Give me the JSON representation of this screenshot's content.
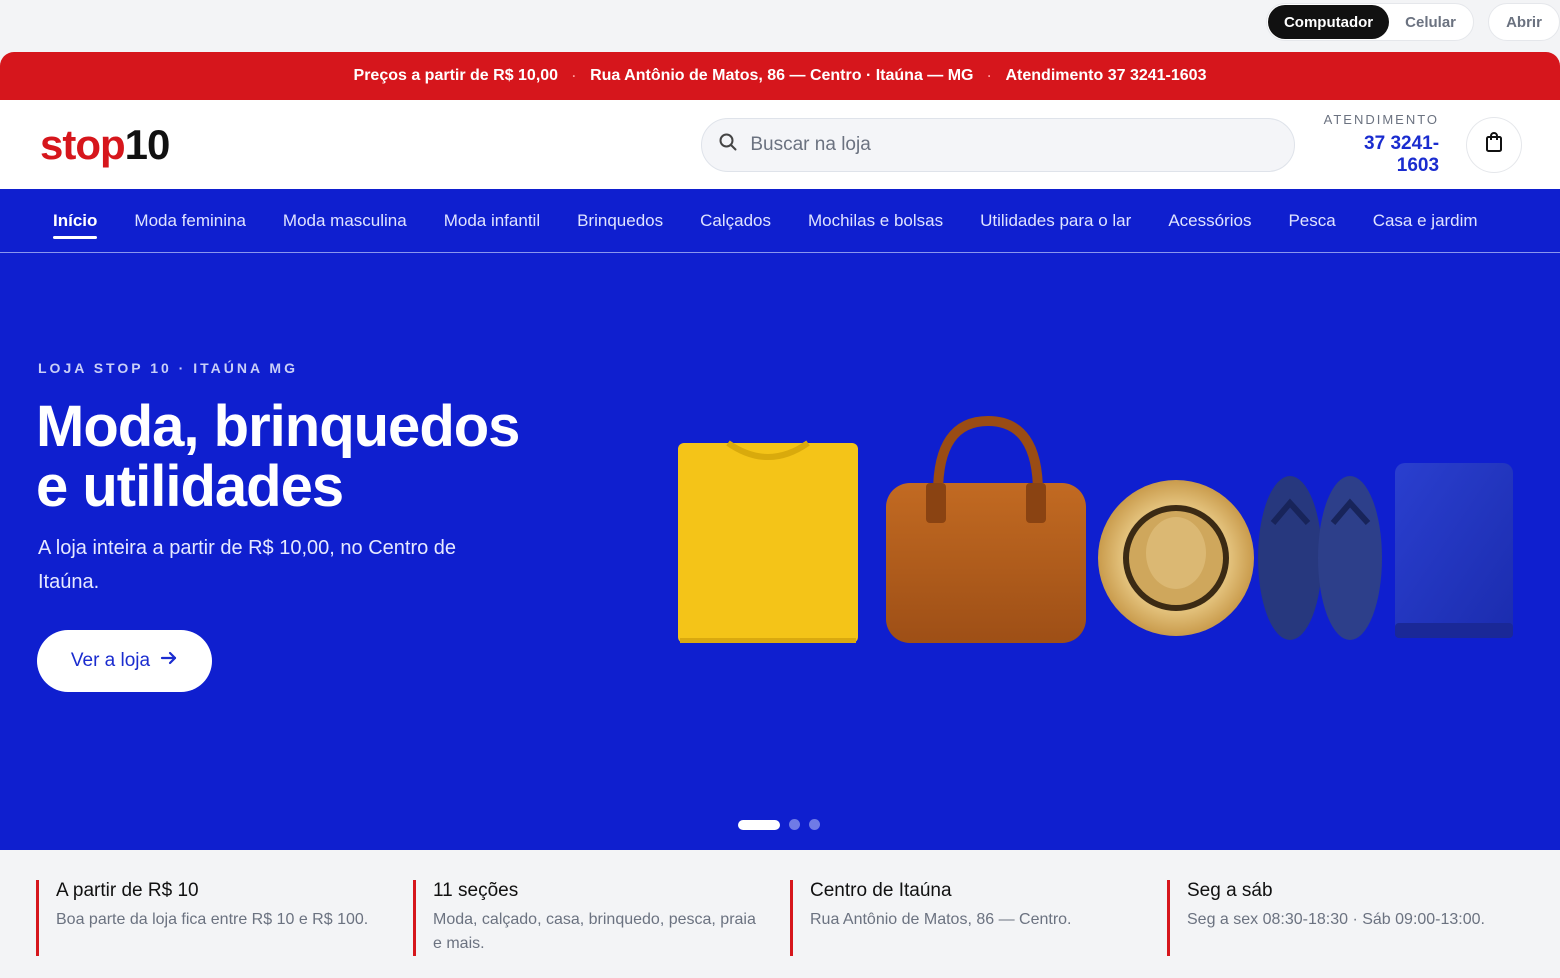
{
  "device_bar": {
    "options": [
      "Computador",
      "Celular"
    ],
    "active": "Computador",
    "open_label": "Abrir"
  },
  "announcement": {
    "items": [
      "Preços a partir de R$ 10,00",
      "Rua Antônio de Matos, 86 — Centro · Itaúna — MG",
      "Atendimento 37 3241-1603"
    ],
    "separator": "·"
  },
  "header": {
    "logo_part1": "stop",
    "logo_part2": "10",
    "search_placeholder": "Buscar na loja",
    "contact_label": "ATENDIMENTO",
    "contact_number": "37 3241-1603"
  },
  "nav": {
    "items": [
      "Início",
      "Moda feminina",
      "Moda masculina",
      "Moda infantil",
      "Brinquedos",
      "Calçados",
      "Mochilas e bolsas",
      "Utilidades para o lar",
      "Acessórios",
      "Pesca",
      "Casa e jardim"
    ],
    "active_index": 0
  },
  "hero": {
    "eyebrow": "LOJA STOP 10 · ITAÚNA MG",
    "headline_line1": "Moda, brinquedos",
    "headline_line2": "e utilidades",
    "subtitle": "A loja inteira a partir de R$ 10,00, no Centro de Itaúna.",
    "cta_label": "Ver a loja",
    "slides_count": 3,
    "active_slide": 0,
    "products": [
      "yellow-tshirt",
      "leather-bag",
      "straw-hat",
      "flip-flops",
      "blue-towel"
    ]
  },
  "features": [
    {
      "title": "A partir de R$ 10",
      "desc": "Boa parte da loja fica entre R$ 10 e R$ 100."
    },
    {
      "title": "11 seções",
      "desc": "Moda, calçado, casa, brinquedo, pesca, praia e mais."
    },
    {
      "title": "Centro de Itaúna",
      "desc": "Rua Antônio de Matos, 86 — Centro."
    },
    {
      "title": "Seg a sáb",
      "desc": "Seg a sex 08:30-18:30 · Sáb 09:00-13:00."
    }
  ],
  "colors": {
    "brand_red": "#d6161c",
    "brand_blue": "#0f1fcf",
    "accent_blue_text": "#1a2ccf"
  }
}
